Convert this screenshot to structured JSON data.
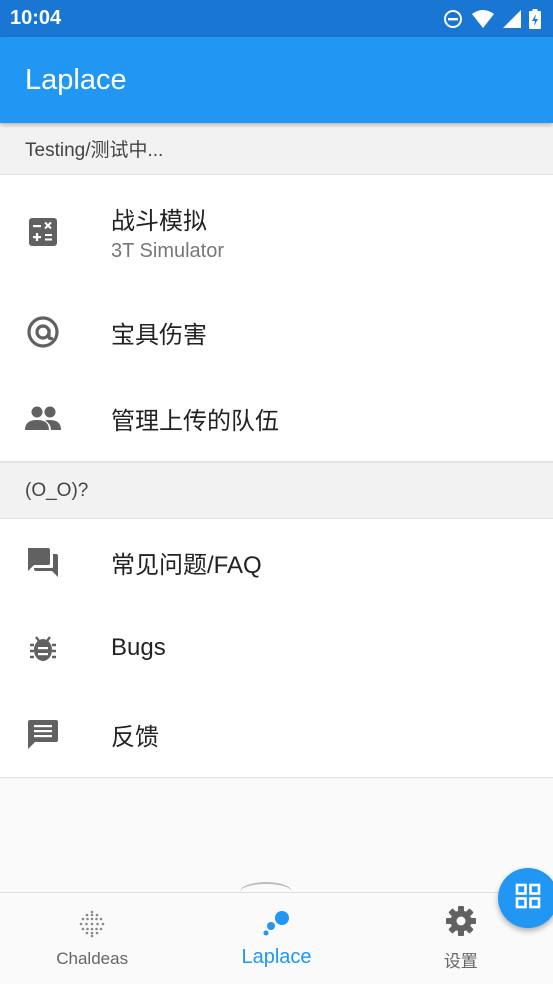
{
  "status_bar": {
    "time": "10:04",
    "icons": [
      "do-not-disturb-icon",
      "wifi-icon",
      "signal-icon",
      "battery-icon"
    ]
  },
  "app_bar": {
    "title": "Laplace"
  },
  "sections": [
    {
      "header": "Testing/测试中...",
      "items": [
        {
          "title": "战斗模拟",
          "subtitle": "3T Simulator",
          "icon": "calculator-icon"
        },
        {
          "title": "宝具伤害",
          "icon": "at-sign-icon"
        },
        {
          "title": "管理上传的队伍",
          "icon": "people-icon"
        }
      ]
    },
    {
      "header": "(O_O)?",
      "items": [
        {
          "title": "常见问题/FAQ",
          "icon": "forum-icon"
        },
        {
          "title": "Bugs",
          "icon": "bug-icon"
        },
        {
          "title": "反馈",
          "icon": "feedback-icon"
        }
      ]
    }
  ],
  "bottom_nav": {
    "items": [
      {
        "label": "Chaldeas",
        "icon": "dot-globe-icon"
      },
      {
        "label": "Laplace",
        "icon": "laplace-dots-icon",
        "active": true
      },
      {
        "label": "设置",
        "icon": "gear-icon"
      }
    ]
  },
  "fab": {
    "icon": "grid-icon"
  },
  "colors": {
    "status_bar": "#1976d2",
    "app_bar": "#2196f3",
    "accent": "#2196f3",
    "icon_gray": "#616161"
  }
}
